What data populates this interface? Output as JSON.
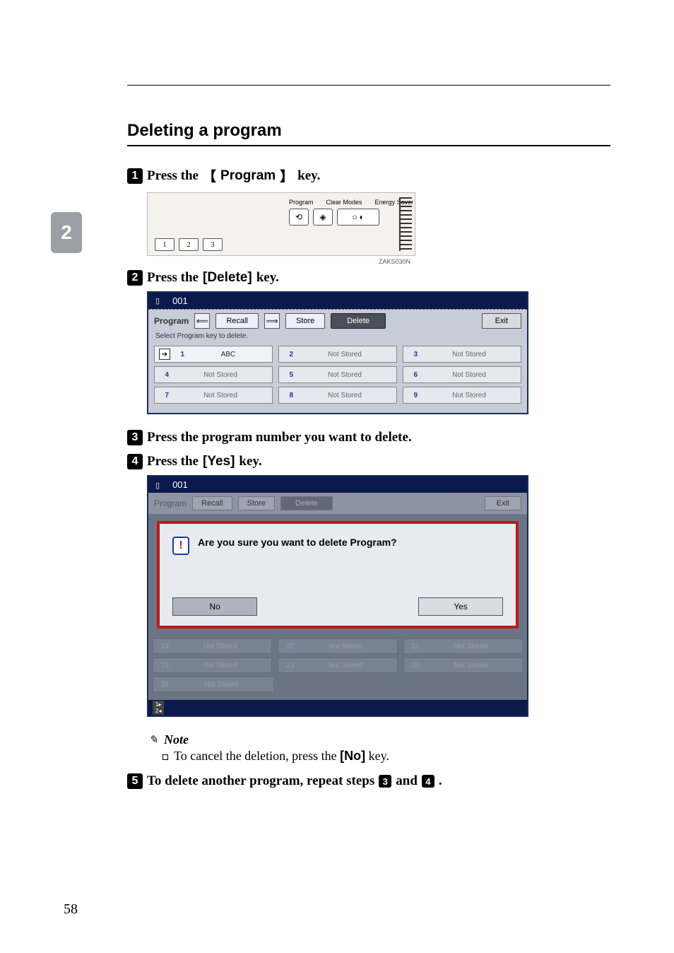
{
  "page_number": "58",
  "side_tab": "2",
  "section_title": "Deleting a program",
  "steps": {
    "s1_a": "Press the ",
    "s1_key": "Program",
    "s1_b": " key.",
    "s2_a": "Press the ",
    "s2_key": "[Delete]",
    "s2_b": " key.",
    "s3": "Press the program number you want to delete.",
    "s4_a": "Press the ",
    "s4_key": "[Yes]",
    "s4_b": " key.",
    "s5_a": "To delete another program, repeat steps ",
    "s5_b": " and ",
    "s5_c": "."
  },
  "step5_refs": {
    "a": "3",
    "b": "4"
  },
  "panel": {
    "labels": {
      "program": "Program",
      "clear": "Clear Modes",
      "energy": "Energy Saver"
    },
    "keys": [
      "1",
      "2",
      "3"
    ],
    "caption": "ZAKS030N"
  },
  "screen1": {
    "title_code": "001",
    "toolbar": {
      "program": "Program",
      "recall": "Recall",
      "store": "Store",
      "delete": "Delete",
      "exit": "Exit"
    },
    "subtext": "Select Program key to delete.",
    "not_stored": "Not Stored",
    "row1_label": "ABC",
    "cells": {
      "r1": [
        "1",
        "2",
        "3"
      ],
      "r2": [
        "4",
        "5",
        "6"
      ],
      "r3": [
        "7",
        "8",
        "9"
      ]
    }
  },
  "screen2": {
    "title_code": "001",
    "toolbar": {
      "program": "Program",
      "recall": "Recall",
      "store": "Store",
      "delete": "Delete",
      "exit": "Exit"
    },
    "dialog_msg": "Are you sure you want to delete Program?",
    "no": "No",
    "yes": "Yes",
    "not_stored": "Not Stored",
    "bg_cells": {
      "r1": [
        "19",
        "20",
        "21"
      ],
      "r2": [
        "22",
        "23",
        "24"
      ],
      "r3": [
        "25"
      ]
    }
  },
  "note": {
    "head": "Note",
    "body_a": "To cancel the deletion, press the ",
    "body_key": "[No]",
    "body_b": " key."
  }
}
